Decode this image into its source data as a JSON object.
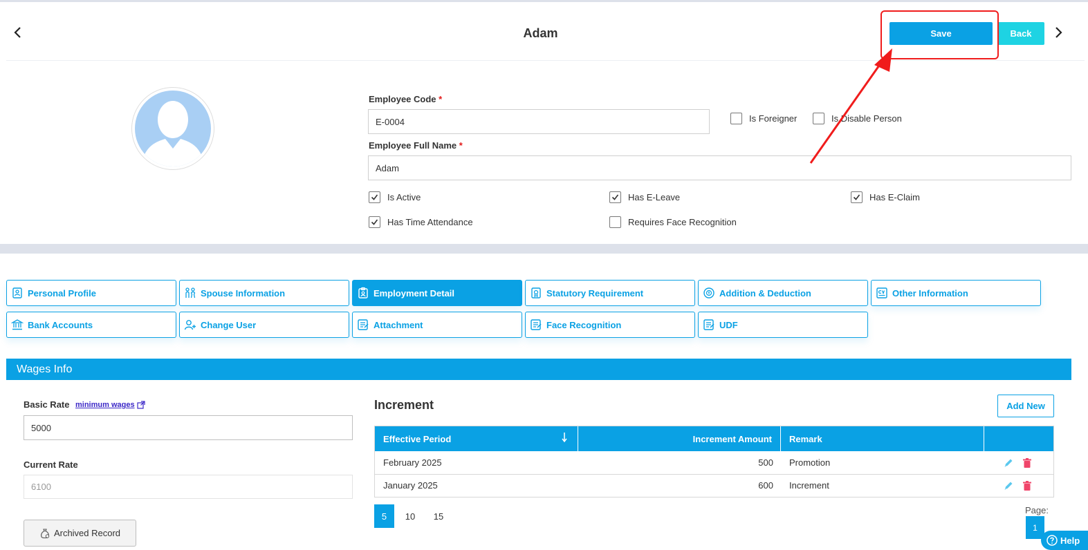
{
  "header": {
    "title": "Adam",
    "save_label": "Save",
    "back_label": "Back"
  },
  "form": {
    "employee_code_label": "Employee Code",
    "employee_code_value": "E-0004",
    "full_name_label": "Employee Full Name",
    "full_name_value": "Adam",
    "required_mark": "*",
    "checkboxes": {
      "is_foreigner": {
        "label": "Is Foreigner",
        "checked": false
      },
      "is_disable_person": {
        "label": "Is Disable Person",
        "checked": false
      },
      "is_active": {
        "label": "Is Active",
        "checked": true
      },
      "has_eleave": {
        "label": "Has E-Leave",
        "checked": true
      },
      "has_eclaim": {
        "label": "Has E-Claim",
        "checked": true
      },
      "has_time_attendance": {
        "label": "Has Time Attendance",
        "checked": true
      },
      "requires_face_recognition": {
        "label": "Requires Face Recognition",
        "checked": false
      }
    }
  },
  "tabs": [
    {
      "label": "Personal Profile",
      "icon": "id-badge-icon",
      "active": false
    },
    {
      "label": "Spouse Information",
      "icon": "couple-icon",
      "active": false
    },
    {
      "label": "Employment Detail",
      "icon": "clipboard-badge-icon",
      "active": true
    },
    {
      "label": "Statutory Requirement",
      "icon": "document-stamp-icon",
      "active": false
    },
    {
      "label": "Addition & Deduction",
      "icon": "coin-cycle-icon",
      "active": false
    },
    {
      "label": "Other Information",
      "icon": "cv-icon",
      "active": false
    },
    {
      "label": "Bank Accounts",
      "icon": "bank-icon",
      "active": false
    },
    {
      "label": "Change User",
      "icon": "user-add-icon",
      "active": false
    },
    {
      "label": "Attachment",
      "icon": "attachment-doc-icon",
      "active": false
    },
    {
      "label": "Face Recognition",
      "icon": "face-doc-icon",
      "active": false
    },
    {
      "label": "UDF",
      "icon": "udf-doc-icon",
      "active": false
    }
  ],
  "wages": {
    "section_title": "Wages Info",
    "basic_rate_label": "Basic Rate",
    "minimum_wages_link": "minimum wages",
    "basic_rate_value": "5000",
    "current_rate_label": "Current Rate",
    "current_rate_value": "6100",
    "archived_label": "Archived Record"
  },
  "increment": {
    "title": "Increment",
    "add_new_label": "Add New",
    "columns": [
      "Effective Period",
      "Increment Amount",
      "Remark"
    ],
    "rows": [
      {
        "period": "February 2025",
        "amount": "500",
        "remark": "Promotion"
      },
      {
        "period": "January 2025",
        "amount": "600",
        "remark": "Increment"
      }
    ],
    "page_sizes": [
      "5",
      "10",
      "15"
    ],
    "selected_page_size": "5",
    "page_label": "Page:",
    "current_page": "1"
  },
  "help_label": "Help",
  "colors": {
    "accent": "#0aa1e4",
    "back_button": "#1ed3e3",
    "highlight": "#f01c1c",
    "delete": "#f0456a"
  }
}
